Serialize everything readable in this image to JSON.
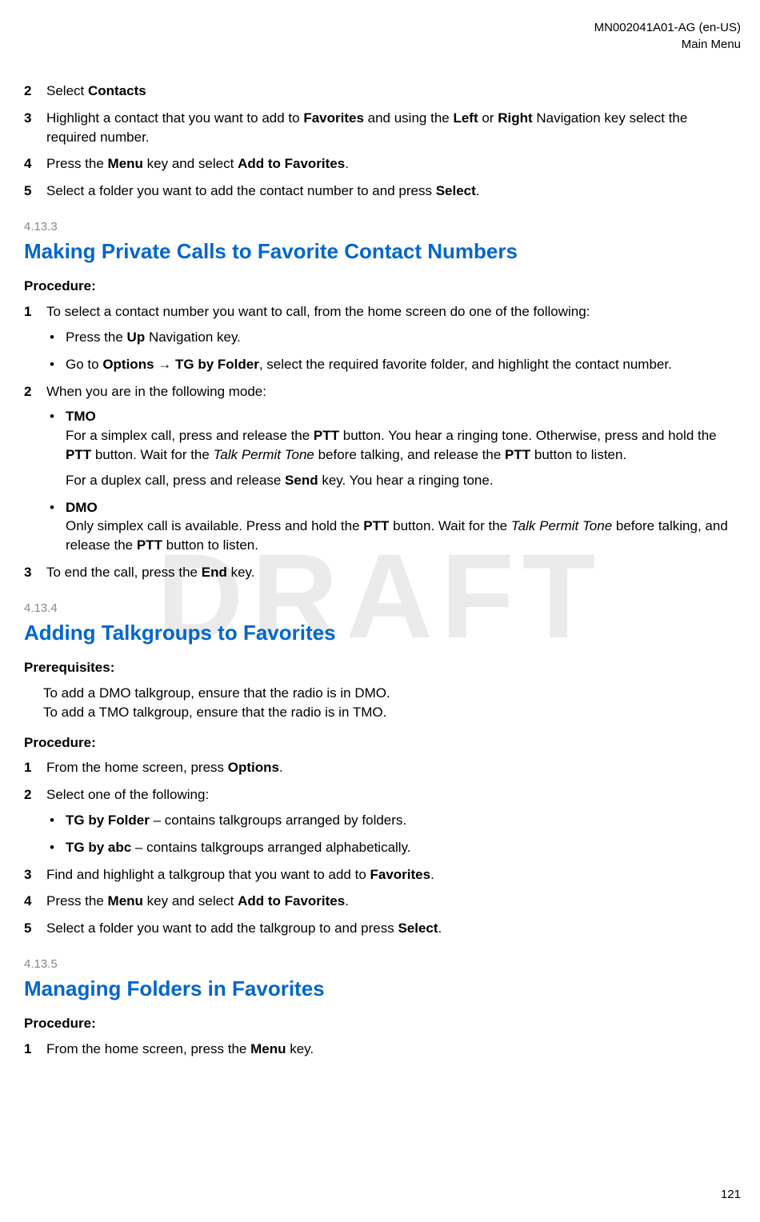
{
  "header": {
    "doc_id": "MN002041A01-AG (en-US)",
    "breadcrumb": "Main Menu"
  },
  "watermark": "DRAFT",
  "page_number": "121",
  "intro_steps": {
    "s2": {
      "num": "2",
      "pre": "Select ",
      "b1": "Contacts"
    },
    "s3": {
      "num": "3",
      "t1": "Highlight a contact that you want to add to ",
      "b1": "Favorites",
      "t2": " and using the ",
      "b2": "Left",
      "t3": " or ",
      "b3": "Right",
      "t4": " Navigation key select the required number."
    },
    "s4": {
      "num": "4",
      "t1": "Press the ",
      "b1": "Menu",
      "t2": " key and select ",
      "b2": "Add to Favorites",
      "t3": "."
    },
    "s5": {
      "num": "5",
      "t1": "Select a folder you want to add the contact number to and press ",
      "b1": "Select",
      "t2": "."
    }
  },
  "sec4133": {
    "num": "4.13.3",
    "title": "Making Private Calls to Favorite Contact Numbers",
    "procedure_label": "Procedure:",
    "s1": {
      "num": "1",
      "text": "To select a contact number you want to call, from the home screen do one of the following:"
    },
    "s1_b1": {
      "t1": "Press the ",
      "b1": "Up",
      "t2": " Navigation key."
    },
    "s1_b2": {
      "t1": "Go to ",
      "b1": "Options",
      "arrow": " → ",
      "b2": "TG by Folder",
      "t2": ", select the required favorite folder, and highlight the contact number."
    },
    "s2": {
      "num": "2",
      "text": "When you are in the following mode:"
    },
    "s2_tmo_label": "TMO",
    "s2_tmo_p1": {
      "t1": "For a simplex call, press and release the ",
      "b1": "PTT",
      "t2": " button. You hear a ringing tone. Otherwise, press and hold the ",
      "b2": "PTT",
      "t3": " button. Wait for the ",
      "i1": "Talk Permit Tone",
      "t4": " before talking, and release the ",
      "b3": "PTT",
      "t5": " button to listen."
    },
    "s2_tmo_p2": {
      "t1": "For a duplex call, press and release ",
      "b1": "Send",
      "t2": " key. You hear a ringing tone."
    },
    "s2_dmo_label": "DMO",
    "s2_dmo_p1": {
      "t1": "Only simplex call is available. Press and hold the ",
      "b1": "PTT",
      "t2": " button. Wait for the ",
      "i1": "Talk Permit Tone",
      "t3": " before talking, and release the ",
      "b2": "PTT",
      "t4": " button to listen."
    },
    "s3": {
      "num": "3",
      "t1": "To end the call, press the ",
      "b1": "End",
      "t2": " key."
    }
  },
  "sec4134": {
    "num": "4.13.4",
    "title": "Adding Talkgroups to Favorites",
    "prereq_label": "Prerequisites:",
    "prereq_line1": "To add a DMO talkgroup, ensure that the radio is in DMO.",
    "prereq_line2": "To add a TMO talkgroup, ensure that the radio is in TMO.",
    "procedure_label": "Procedure:",
    "s1": {
      "num": "1",
      "t1": "From the home screen, press ",
      "b1": "Options",
      "t2": "."
    },
    "s2": {
      "num": "2",
      "text": "Select one of the following:"
    },
    "s2_b1": {
      "b1": "TG by Folder",
      "t1": " – contains talkgroups arranged by folders."
    },
    "s2_b2": {
      "b1": "TG by abc",
      "t1": " – contains talkgroups arranged alphabetically."
    },
    "s3": {
      "num": "3",
      "t1": "Find and highlight a talkgroup that you want to add to ",
      "b1": "Favorites",
      "t2": "."
    },
    "s4": {
      "num": "4",
      "t1": "Press the ",
      "b1": "Menu",
      "t2": " key and select ",
      "b2": "Add to Favorites",
      "t3": "."
    },
    "s5": {
      "num": "5",
      "t1": "Select a folder you want to add the talkgroup to and press ",
      "b1": "Select",
      "t2": "."
    }
  },
  "sec4135": {
    "num": "4.13.5",
    "title": "Managing Folders in Favorites",
    "procedure_label": "Procedure:",
    "s1": {
      "num": "1",
      "t1": "From the home screen, press the ",
      "b1": "Menu",
      "t2": " key."
    }
  }
}
